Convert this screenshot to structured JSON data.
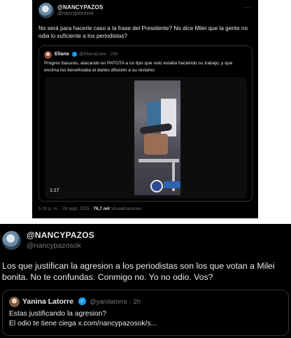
{
  "tweet_top": {
    "display_name": "@NANCYPAZOS",
    "handle": "@nancypazosok",
    "more_icon": "more-horizontal-icon",
    "text": "No será para hacerle caso a la frase del Presidente? No dice Milei que la gente no odia lo suficiente a los periodistas?",
    "quote": {
      "display_name": "Eliana",
      "handle_time": "@ElianaCere · 20h",
      "text": "Progres basuras, atacando en PATOTA a un tipo que solo estaba haciendo su trabajo, y que encima los beneficiaba al darles difusión a su reclamo",
      "video_duration": "1:17"
    },
    "timestamp": "5:02 p. m. · 28 sept. 2025 · ",
    "views_count": "76,7 mil",
    "views_label": " Visualizaciones"
  },
  "tweet_bottom": {
    "display_name": "@NANCYPAZOS",
    "handle": "@nancypazosok",
    "text": "Los que justifican la agresion a los periodistas son los que votan a Milei bonita. No te confundas. Conmigo no. Yo no odio. Vos?",
    "quote": {
      "display_name": "Yanina Latorre",
      "verified_icon": "verified-badge-icon",
      "handle_time": "@yanilatorre · 2h",
      "line1": "Estas justificando la agresion?",
      "line2": "El odio te tiene ciega x.com/nancypazosok/s..."
    }
  },
  "colors": {
    "background": "#000000",
    "text": "#e7e9ea",
    "muted": "#71767b",
    "border": "#2f3336",
    "verified": "#1d9bf0"
  }
}
